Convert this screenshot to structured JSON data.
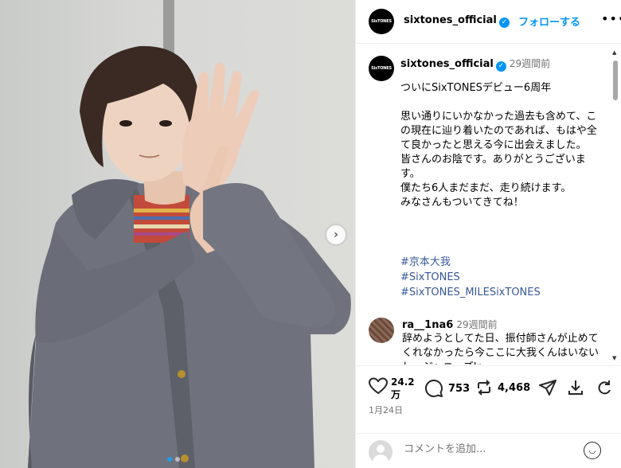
{
  "post": {
    "username": "sixtones_official",
    "avatar_text": "SixTONES",
    "follow_label": "フォローする",
    "more_label": "•••"
  },
  "caption": {
    "username": "sixtones_official",
    "time": "29週間前",
    "text": "ついにSixTONESデビュー6周年\n\n思い通りにいかなかった過去も含めて、この現在に辿り着いたのであれば、もはや全て良かったと思える今に出会えました。\n皆さんのお陰です。ありがとうございます。\n僕たち6人まだまだ、走り続けます。\nみなさんもついてきてね！",
    "hashtags": [
      "#京本大我",
      "#SixTONES",
      "#SixTONES_MILESixTONES"
    ]
  },
  "comment": {
    "username": "ra__1na6",
    "time": "29週間前",
    "text": "辞めようとしてた日、振付師さんが止めてくれなかったら今ここに大我くんはいないし、ジャニーズJr"
  },
  "actions": {
    "likes": "24.2万",
    "comments": "753",
    "reposts": "4,468",
    "date": "1月24日"
  },
  "add_comment": {
    "placeholder": "コメントを追加..."
  },
  "carousel": {
    "slides": 2,
    "active": 1
  },
  "colors": {
    "accent": "#0095f6",
    "hashtag": "#385898"
  }
}
